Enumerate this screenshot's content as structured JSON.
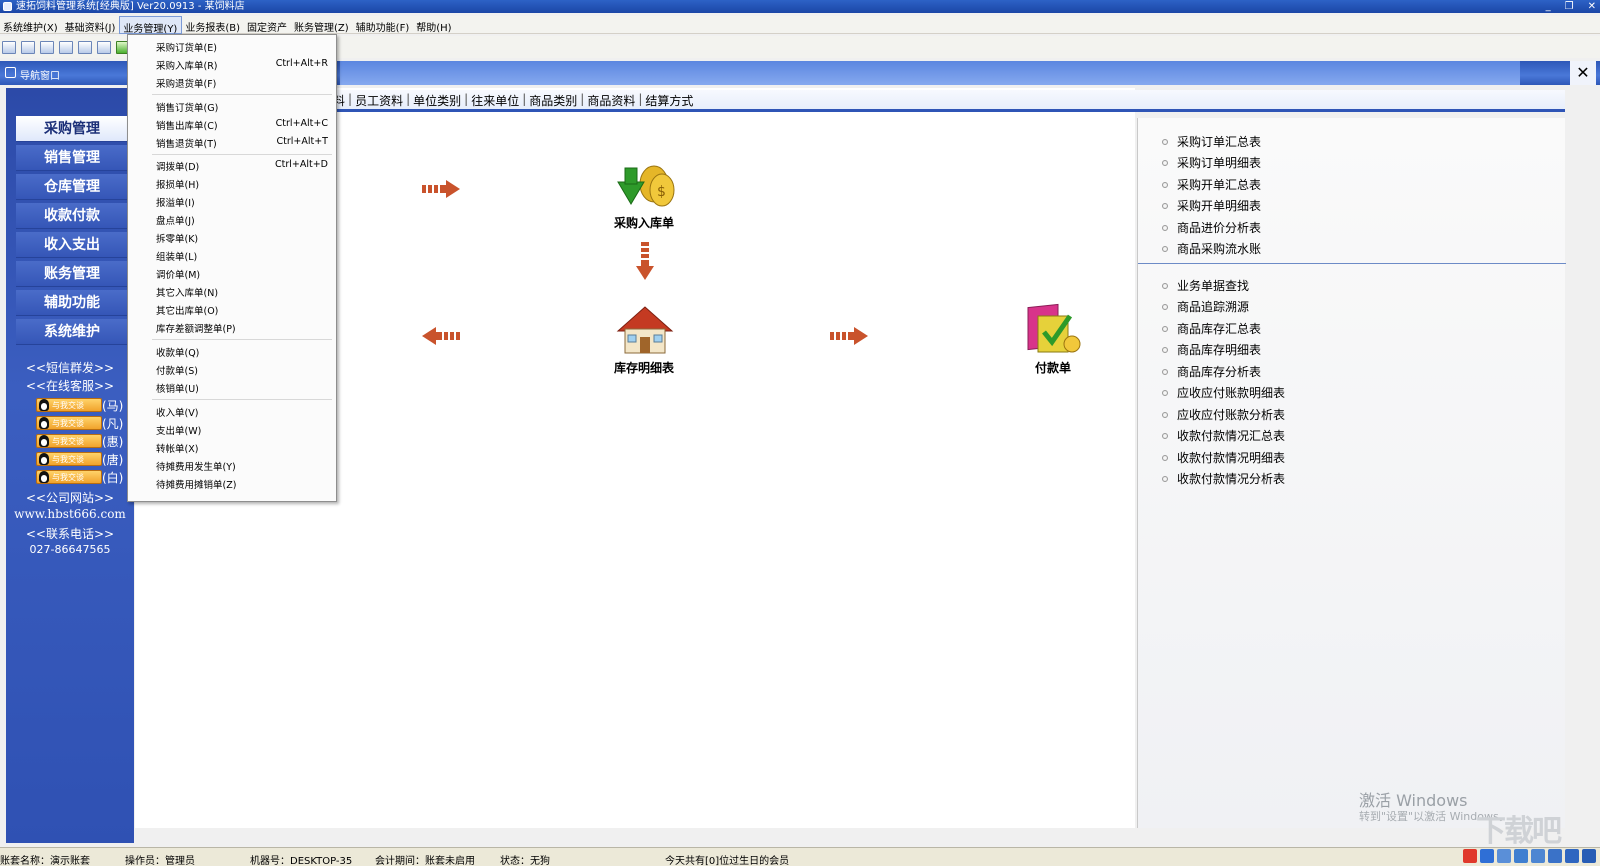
{
  "window": {
    "title": "速拓饲料管理系统[经典版] Ver20.0913  -  某饲料店",
    "controls": [
      "_",
      "❐",
      "✕"
    ]
  },
  "menubar": [
    {
      "label": "系统维护(X)"
    },
    {
      "label": "基础资料(J)"
    },
    {
      "label": "业务管理(Y)"
    },
    {
      "label": "业务报表(B)"
    },
    {
      "label": "固定资产"
    },
    {
      "label": "账务管理(Z)"
    },
    {
      "label": "辅助功能(F)"
    },
    {
      "label": "帮助(H)"
    }
  ],
  "nav_window": {
    "title": "导航窗口",
    "close": "✕"
  },
  "sidebar": {
    "modules": [
      "采购管理",
      "销售管理",
      "仓库管理",
      "收款付款",
      "收入支出",
      "账务管理",
      "辅助功能",
      "系统维护"
    ],
    "links": {
      "sms": "<<短信群发>>",
      "online": "<<在线客服>>",
      "website": "<<公司网站>>",
      "url": "www.hbst666.com",
      "phone_label": "<<联系电话>>",
      "phone": "027-86647565"
    },
    "qq": [
      {
        "badge": "与我交谈",
        "name": "(马)"
      },
      {
        "badge": "与我交谈",
        "name": "(凡)"
      },
      {
        "badge": "与我交谈",
        "name": "(惠)"
      },
      {
        "badge": "与我交谈",
        "name": "(唐)"
      },
      {
        "badge": "与我交谈",
        "name": "(白)"
      }
    ]
  },
  "tabs": [
    "料",
    "员工资料",
    "单位类别",
    "往来单位",
    "商品类别",
    "商品资料",
    "结算方式"
  ],
  "flow": {
    "purchase_in": "采购入库单",
    "stock_detail": "库存明细表",
    "payment": "付款单"
  },
  "dropdown": {
    "items": [
      {
        "label": "采购订货单(E)",
        "shortcut": ""
      },
      {
        "label": "采购入库单(R)",
        "shortcut": "Ctrl+Alt+R"
      },
      {
        "label": "采购退货单(F)",
        "shortcut": ""
      },
      {
        "label": "销售订货单(G)",
        "shortcut": ""
      },
      {
        "label": "销售出库单(C)",
        "shortcut": "Ctrl+Alt+C"
      },
      {
        "label": "销售退货单(T)",
        "shortcut": "Ctrl+Alt+T"
      },
      {
        "label": "调拨单(D)",
        "shortcut": "Ctrl+Alt+D"
      },
      {
        "label": "报损单(H)",
        "shortcut": ""
      },
      {
        "label": "报溢单(I)",
        "shortcut": ""
      },
      {
        "label": "盘点单(J)",
        "shortcut": ""
      },
      {
        "label": "拆零单(K)",
        "shortcut": ""
      },
      {
        "label": "组装单(L)",
        "shortcut": ""
      },
      {
        "label": "调价单(M)",
        "shortcut": ""
      },
      {
        "label": "其它入库单(N)",
        "shortcut": ""
      },
      {
        "label": "其它出库单(O)",
        "shortcut": ""
      },
      {
        "label": "库存差额调整单(P)",
        "shortcut": ""
      },
      {
        "label": "收款单(Q)",
        "shortcut": ""
      },
      {
        "label": "付款单(S)",
        "shortcut": ""
      },
      {
        "label": "核销单(U)",
        "shortcut": ""
      },
      {
        "label": "收入单(V)",
        "shortcut": ""
      },
      {
        "label": "支出单(W)",
        "shortcut": ""
      },
      {
        "label": "转帐单(X)",
        "shortcut": ""
      },
      {
        "label": "待摊费用发生单(Y)",
        "shortcut": ""
      },
      {
        "label": "待摊费用摊销单(Z)",
        "shortcut": ""
      }
    ]
  },
  "reports_top": [
    "采购订单汇总表",
    "采购订单明细表",
    "采购开单汇总表",
    "采购开单明细表",
    "商品进价分析表",
    "商品采购流水账"
  ],
  "reports_bottom": [
    "业务单据查找",
    "商品追踪溯源",
    "商品库存汇总表",
    "商品库存明细表",
    "商品库存分析表",
    "应收应付账款明细表",
    "应收应付账款分析表",
    "收款付款情况汇总表",
    "收款付款情况明细表",
    "收款付款情况分析表"
  ],
  "watermark": {
    "title": "激活 Windows",
    "sub": "转到\"设置\"以激活 Windows。",
    "logo": "下载吧"
  },
  "status": {
    "account": "账套名称：演示账套",
    "operator": "操作员：管理员",
    "machine": "机器号：DESKTOP-35",
    "period": "会计期间：账套未启用",
    "state": "状态：无狗",
    "birthday": "今天共有[0]位过生日的会员"
  },
  "colors": {
    "accent": "#2f55b6",
    "sidebar": "#3556b7",
    "menu_highlight": "#dfe7f7"
  }
}
